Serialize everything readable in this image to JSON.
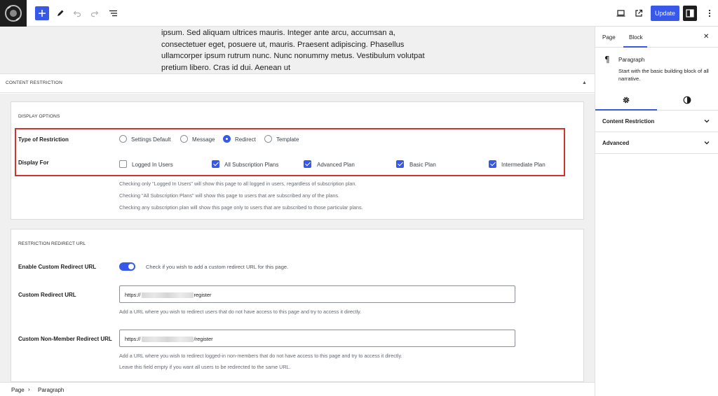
{
  "toolbar": {
    "update_label": "Update",
    "icons": [
      "site-logo",
      "plus-icon",
      "pencil-icon",
      "undo-icon",
      "redo-icon",
      "list-view-icon",
      "desktop-preview-icon",
      "external-link-icon",
      "sidebar-toggle-icon",
      "more-vertical-icon"
    ],
    "accent_color": "#3858e9"
  },
  "editor": {
    "paragraph_lines": [
      "ipsum. Sed aliquam ultrices mauris. Integer ante arcu, accumsan a,",
      "consectetuer eget, posuere ut, mauris. Praesent adipiscing. Phasellus",
      "ullamcorper ipsum rutrum nunc. Nunc nonummy metus. Vestibulum volutpat",
      "pretium libero. Cras id dui. Aenean ut"
    ]
  },
  "content_restriction": {
    "header_title": "CONTENT RESTRICTION",
    "display_options": {
      "title": "DISPLAY OPTIONS",
      "type_label": "Type of Restriction",
      "type_options": [
        "Settings Default",
        "Message",
        "Redirect",
        "Template"
      ],
      "type_selected": "Redirect",
      "display_for_label": "Display For",
      "display_for_options": [
        {
          "label": "Logged In Users",
          "checked": false
        },
        {
          "label": "All Subscription Plans",
          "checked": true
        },
        {
          "label": "Advanced Plan",
          "checked": true
        },
        {
          "label": "Basic Plan",
          "checked": true
        },
        {
          "label": "Intermediate Plan",
          "checked": true
        }
      ],
      "help": [
        "Checking only \"Logged In Users\" will show this page to all logged in users, regardless of subscription plan.",
        "Checking \"All Subscription Plans\" will show this page to users that are subscribed any of the plans.",
        "Checking any subscription plan will show this page only to users that are subscribed to those particular plans."
      ],
      "highlight_color": "#d0342c"
    },
    "redirect": {
      "title": "RESTRICTION REDIRECT URL",
      "enable_label": "Enable Custom Redirect URL",
      "enable_on": true,
      "enable_help": "Check if you wish to add a custom redirect URL for this page.",
      "custom_url_label": "Custom Redirect URL",
      "custom_url_prefix": "https://",
      "custom_url_suffix": "register",
      "custom_url_help": "Add a URL where you wish to redirect users that do not have access to this page and try to access it directly.",
      "non_member_label": "Custom Non-Member Redirect URL",
      "non_member_prefix": "https://",
      "non_member_suffix": "/register",
      "non_member_help": [
        "Add a URL where you wish to redirect logged-in non-members that do not have access to this page and try to access it directly.",
        "Leave this field empty if you want all users to be redirected to the same URL."
      ]
    }
  },
  "footer": {
    "breadcrumb": [
      "Page",
      "Paragraph"
    ]
  },
  "sidebar": {
    "tabs": [
      "Page",
      "Block"
    ],
    "active_tab": "Block",
    "block_name": "Paragraph",
    "block_desc": "Start with the basic building block of all narrative.",
    "panels": [
      "Content Restriction",
      "Advanced"
    ]
  }
}
